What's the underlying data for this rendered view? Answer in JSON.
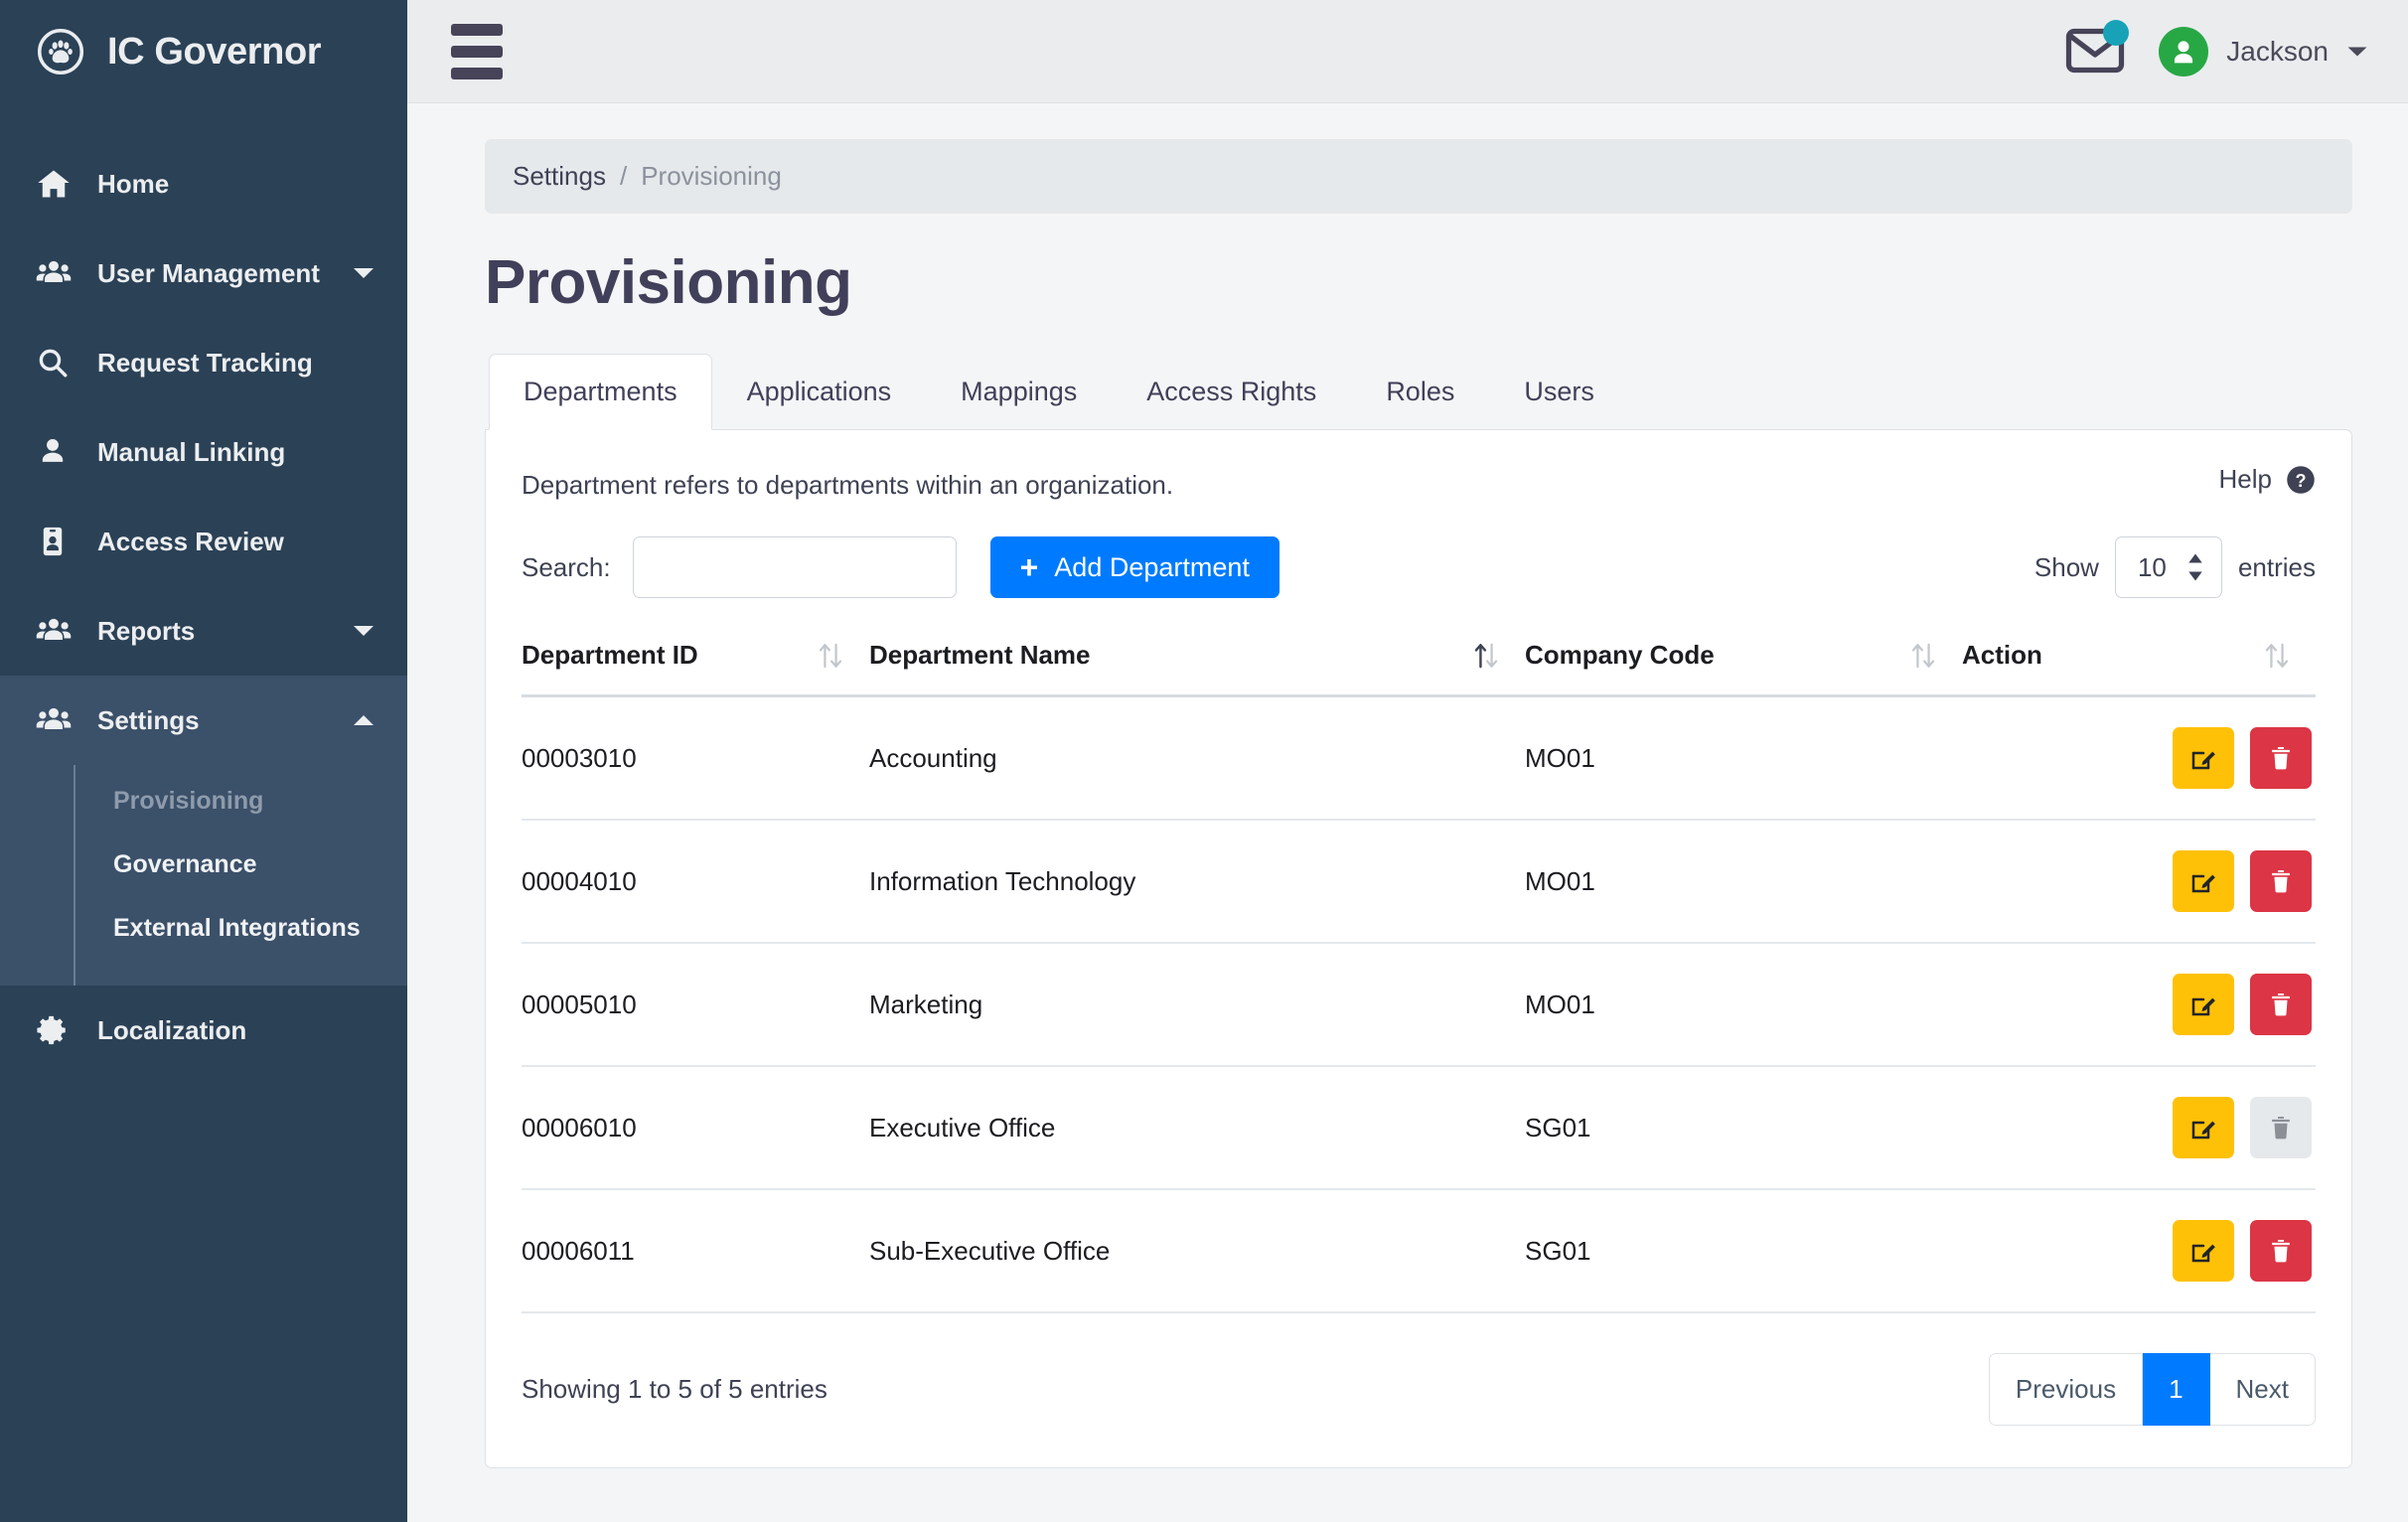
{
  "brand": {
    "title": "IC Governor",
    "icon": "paw-circle-icon"
  },
  "sidebar": {
    "items": [
      {
        "label": "Home",
        "icon": "home-icon",
        "expandable": false
      },
      {
        "label": "User Management",
        "icon": "users-icon",
        "expandable": true
      },
      {
        "label": "Request Tracking",
        "icon": "search-icon",
        "expandable": false
      },
      {
        "label": "Manual Linking",
        "icon": "user-icon",
        "expandable": false
      },
      {
        "label": "Access Review",
        "icon": "id-badge-icon",
        "expandable": false
      },
      {
        "label": "Reports",
        "icon": "users-icon",
        "expandable": true
      },
      {
        "label": "Settings",
        "icon": "users-icon",
        "expandable": true
      },
      {
        "label": "Localization",
        "icon": "gear-icon",
        "expandable": false
      }
    ],
    "settings_submenu": [
      {
        "label": "Provisioning",
        "active": true
      },
      {
        "label": "Governance",
        "active": false
      },
      {
        "label": "External Integrations",
        "active": false
      }
    ]
  },
  "topbar": {
    "menu_icon": "hamburger-icon",
    "mail_icon": "envelope-icon",
    "mail_badge_color": "#17a2b8",
    "avatar_color": "#28a745",
    "user_name": "Jackson"
  },
  "breadcrumb": {
    "parent": "Settings",
    "separator": "/",
    "current": "Provisioning"
  },
  "page": {
    "title": "Provisioning"
  },
  "tabs": [
    {
      "label": "Departments",
      "active": true
    },
    {
      "label": "Applications",
      "active": false
    },
    {
      "label": "Mappings",
      "active": false
    },
    {
      "label": "Access Rights",
      "active": false
    },
    {
      "label": "Roles",
      "active": false
    },
    {
      "label": "Users",
      "active": false
    }
  ],
  "panel": {
    "description": "Department refers to departments within an organization.",
    "help_label": "Help",
    "help_icon": "question-circle-icon"
  },
  "toolbar": {
    "search_label": "Search:",
    "search_value": "",
    "search_placeholder": "",
    "add_button": "Add Department",
    "add_button_color": "#007bff",
    "show_label": "Show",
    "entries_value": "10",
    "entries_label": "entries"
  },
  "table": {
    "columns": [
      "Department ID",
      "Department Name",
      "Company Code",
      "Action"
    ],
    "rows": [
      {
        "id": "00003010",
        "name": "Accounting",
        "code": "MO01",
        "delete_enabled": true
      },
      {
        "id": "00004010",
        "name": "Information Technology",
        "code": "MO01",
        "delete_enabled": true
      },
      {
        "id": "00005010",
        "name": "Marketing",
        "code": "MO01",
        "delete_enabled": true
      },
      {
        "id": "00006010",
        "name": "Executive Office",
        "code": "SG01",
        "delete_enabled": false
      },
      {
        "id": "00006011",
        "name": "Sub-Executive Office",
        "code": "SG01",
        "delete_enabled": true
      }
    ],
    "edit_icon": "edit-pencil-icon",
    "delete_icon": "trash-icon",
    "edit_color": "#ffc107",
    "delete_color": "#dc3545"
  },
  "footer": {
    "showing": "Showing 1 to 5 of 5 entries",
    "pagination": {
      "previous": "Previous",
      "pages": [
        "1"
      ],
      "next": "Next",
      "active_page": "1"
    }
  }
}
